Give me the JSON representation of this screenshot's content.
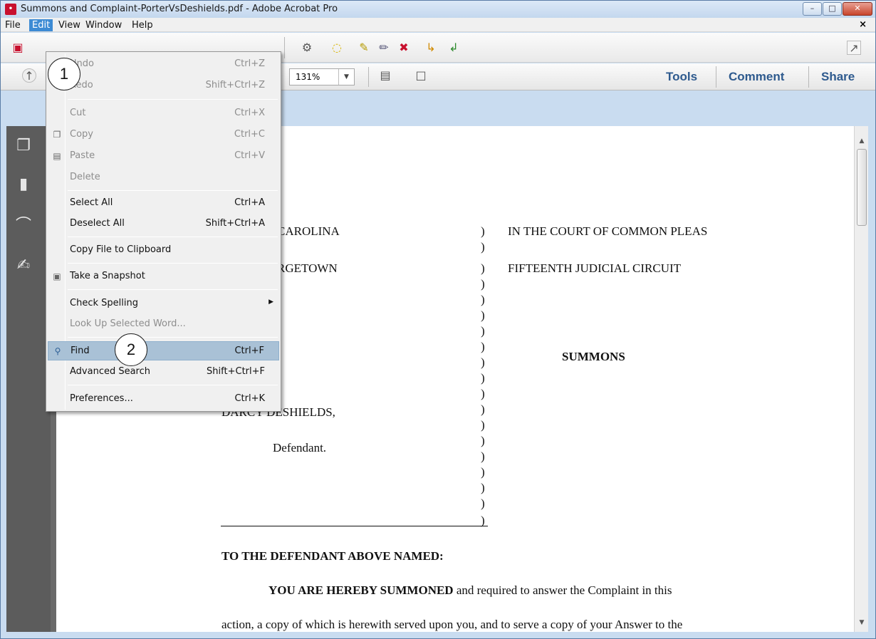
{
  "window": {
    "title": "Summons and Complaint-PorterVsDeshields.pdf - Adobe Acrobat Pro",
    "min_glyph": "–",
    "max_glyph": "□",
    "close_glyph": "✕"
  },
  "menubar": {
    "items": [
      {
        "label": "File"
      },
      {
        "label": "Edit"
      },
      {
        "label": "View"
      },
      {
        "label": "Window"
      },
      {
        "label": "Help"
      }
    ],
    "close_glyph": "×"
  },
  "toolbar": {
    "zoom_value": "131%",
    "tools_label": "Tools",
    "comment_label": "Comment",
    "share_label": "Share"
  },
  "edit_menu": {
    "items": [
      {
        "label": "Undo",
        "shortcut": "Ctrl+Z",
        "enabled": false
      },
      {
        "label": "Redo",
        "shortcut": "Shift+Ctrl+Z",
        "enabled": false
      },
      {
        "label": "Cut",
        "shortcut": "Ctrl+X",
        "enabled": false
      },
      {
        "label": "Copy",
        "shortcut": "Ctrl+C",
        "enabled": false
      },
      {
        "label": "Paste",
        "shortcut": "Ctrl+V",
        "enabled": false
      },
      {
        "label": "Delete",
        "shortcut": "",
        "enabled": false
      },
      {
        "label": "Select All",
        "shortcut": "Ctrl+A",
        "enabled": true
      },
      {
        "label": "Deselect All",
        "shortcut": "Shift+Ctrl+A",
        "enabled": true
      },
      {
        "label": "Copy File to Clipboard",
        "shortcut": "",
        "enabled": true
      },
      {
        "label": "Take a Snapshot",
        "shortcut": "",
        "enabled": true
      },
      {
        "label": "Check Spelling",
        "shortcut": "",
        "enabled": true
      },
      {
        "label": "Look Up Selected Word...",
        "shortcut": "",
        "enabled": false
      },
      {
        "label": "Find",
        "shortcut": "Ctrl+F",
        "enabled": true,
        "highlighted": true
      },
      {
        "label": "Advanced Search",
        "shortcut": "Shift+Ctrl+F",
        "enabled": true
      },
      {
        "label": "Preferences...",
        "shortcut": "Ctrl+K",
        "enabled": true
      }
    ]
  },
  "callouts": {
    "first": "1",
    "second": "2"
  },
  "document": {
    "state_fragment": "CAROLINA",
    "county_fragment": "RGETOWN",
    "court_line": "IN THE COURT OF COMMON PLEAS",
    "circuit_line": "FIFTEENTH JUDICIAL CIRCUIT",
    "summons_title": "SUMMONS",
    "defendant_name_fragment": "DARCY DESHIELDS,",
    "defendant_label": "Defendant.",
    "paren": ")",
    "to_defendant": "TO THE DEFENDANT ABOVE NAMED:",
    "summoned_bold": "YOU ARE HEREBY SUMMONED",
    "summoned_rest": " and required to answer the Complaint in this",
    "action_line": "action, a copy of which is herewith served upon you, and to serve a copy of your Answer to the"
  }
}
